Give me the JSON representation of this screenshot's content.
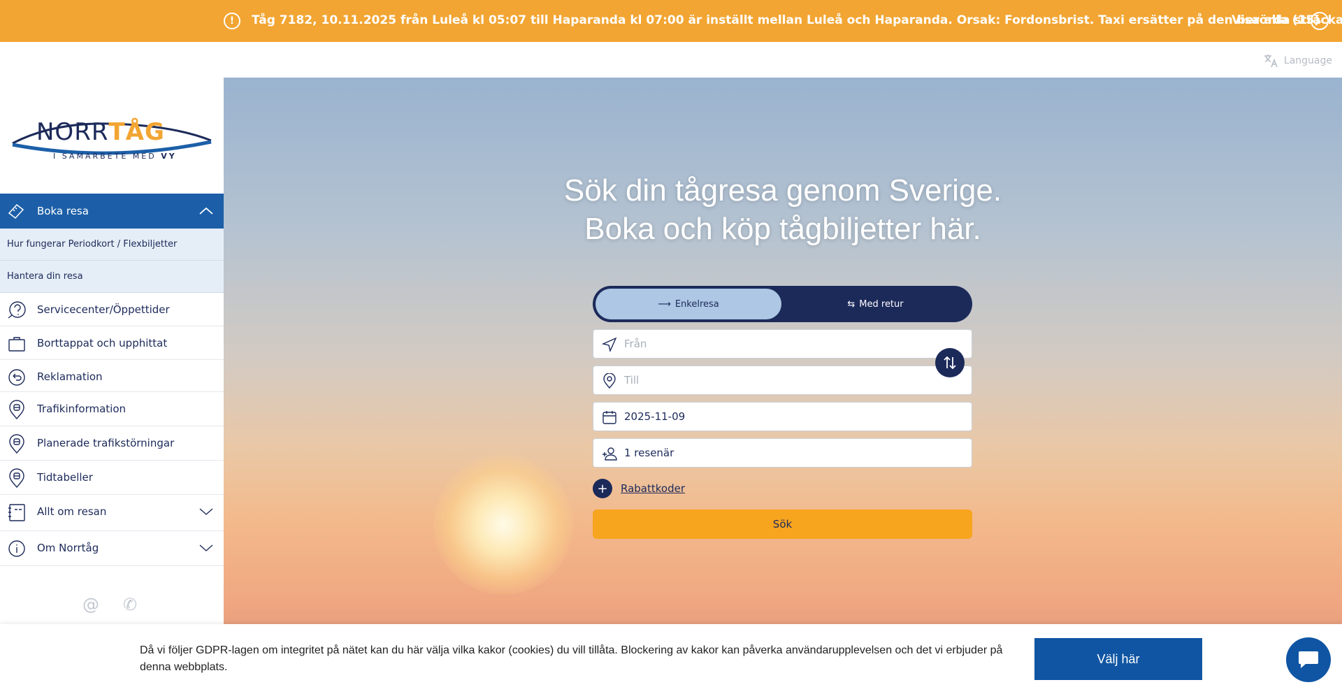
{
  "alert": {
    "message": "Tåg 7182, 10.11.2025 från Luleå kl 05:07 till Haparanda kl 07:00 är inställt mellan Luleå och Haparanda. Orsak: Fordonsbrist. Taxi ersätter på den berörda sträckan.",
    "view_all": "Visa alla (15)",
    "icon": "exclamation-icon",
    "color": "#f2a532"
  },
  "language": {
    "label": "Language",
    "icon": "translate-icon"
  },
  "logo": {
    "part1": "NORR",
    "part2": "TÅG",
    "sub_prefix": "I SAMARBETE MED ",
    "sub_brand": "VY"
  },
  "sidebar": {
    "active": {
      "label": "Boka resa",
      "icon": "ticket-icon"
    },
    "sub_items": [
      {
        "label": "Hur fungerar Periodkort / Flexbiljetter"
      },
      {
        "label": "Hantera din resa"
      }
    ],
    "items": [
      {
        "label": "Servicecenter/Öppettider",
        "icon": "help-icon"
      },
      {
        "label": "Borttappat och upphittat",
        "icon": "briefcase-icon"
      },
      {
        "label": "Reklamation",
        "icon": "return-icon"
      },
      {
        "label": "Trafikinformation",
        "icon": "train-pin-icon"
      },
      {
        "label": "Planerade trafikstörningar",
        "icon": "train-pin-icon"
      },
      {
        "label": "Tidtabeller",
        "icon": "train-pin-icon"
      },
      {
        "label": "Allt om resan",
        "icon": "notebook-icon",
        "expandable": true
      },
      {
        "label": "Om Norrtåg",
        "icon": "info-icon",
        "expandable": true
      }
    ],
    "contact_icons": [
      "at-icon",
      "phone-icon"
    ]
  },
  "hero": {
    "title_line1": "Sök din tågresa genom Sverige.",
    "title_line2": "Boka och köp tågbiljetter här."
  },
  "search": {
    "trip_one_way": "Enkelresa",
    "trip_return": "Med retur",
    "from_placeholder": "Från",
    "to_placeholder": "Till",
    "date_value": "2025-11-09",
    "passengers_value": "1 resenär",
    "discount_label": "Rabattkoder",
    "search_label": "Sök"
  },
  "cookie": {
    "text": "Då vi följer GDPR-lagen om integritet på nätet kan du här välja vilka kakor (cookies) du vill tillåta. Blockering av kakor kan påverka användarupplevelsen och det vi erbjuder på denna webbplats.",
    "button": "Välj här"
  },
  "colors": {
    "navy": "#1c2a5a",
    "blue": "#1c5fa8",
    "orange": "#f7a41f",
    "cookie_blue": "#0f55a3"
  }
}
